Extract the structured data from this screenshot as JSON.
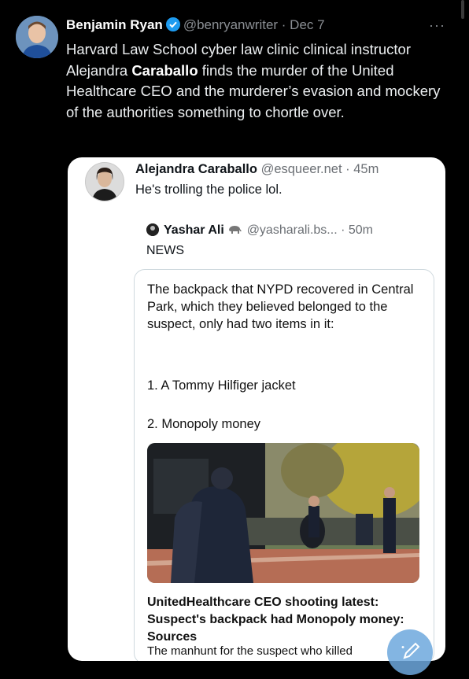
{
  "outer_tweet": {
    "author_name": "Benjamin Ryan",
    "handle_date": "@benryanwriter · Dec 7",
    "more": "···",
    "text_part1": "Harvard Law School cyber law clinic clinical instructor Alejandra ",
    "text_bold": "Caraballo",
    "text_part2": " finds the murder of the United Healthcare CEO and the murderer’s evasion and mockery of the authorities something to chortle over."
  },
  "quoted_tweet": {
    "author_name": "Alejandra Caraballo",
    "handle_time": "@esqueer.net · 45m",
    "text": "He's trolling the police lol."
  },
  "nested_tweet": {
    "author_name": "Yashar Ali",
    "handle_time": "@yasharali.bs... · 50m",
    "label": "NEWS",
    "body": "The backpack that NYPD recovered in Central Park, which they believed belonged to the suspect, only had two items in it:",
    "item1": "1. A Tommy Hilfiger jacket",
    "item2": "2. Monopoly money",
    "link_title": "UnitedHealthcare CEO shooting latest: Suspect's backpack had Monopoly money: Sources",
    "link_snippet": "The manhunt for the suspect who killed"
  },
  "colors": {
    "background": "#000000",
    "verified_badge": "#1d9bf0",
    "card": "#ffffff",
    "compose_fab": "#6ea9de"
  }
}
